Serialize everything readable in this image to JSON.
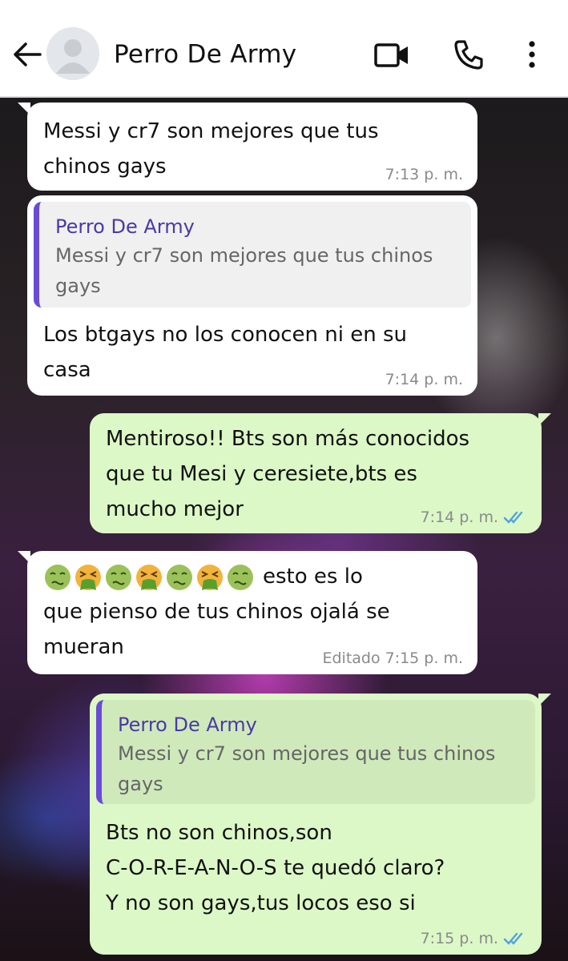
{
  "header": {
    "contact_name": "Perro De Army"
  },
  "messages": [
    {
      "direction": "incoming",
      "text": "Messi y cr7 son mejores que tus\nchinos gays",
      "time": "7:13 p. m."
    },
    {
      "direction": "incoming",
      "quote": {
        "author": "Perro De Army",
        "text": "Messi y cr7 son mejores que tus chinos\ngays"
      },
      "text": "Los btgays no los conocen ni en su\ncasa",
      "time": "7:14 p. m."
    },
    {
      "direction": "outgoing",
      "text": "Mentiroso!! Bts son más conocidos\nque tu Mesi y ceresiete,bts es\nmucho mejor",
      "time": "7:14 p. m.",
      "status": "read"
    },
    {
      "direction": "incoming",
      "emojis": [
        "nauseated-face",
        "vomiting-face",
        "nauseated-face",
        "vomiting-face",
        "nauseated-face",
        "vomiting-face",
        "nauseated-face"
      ],
      "text_first_line": "esto es lo",
      "text": "que pienso de tus chinos ojalá se\nmueran",
      "edited_label": "Editado",
      "time": "7:15 p. m."
    },
    {
      "direction": "outgoing",
      "quote": {
        "author": "Perro De Army",
        "text": "Messi y cr7 son mejores que tus chinos\ngays"
      },
      "text": "Bts no son chinos,son\nC-O-R-E-A-N-O-S te quedó claro?\nY no son gays,tus locos eso si",
      "time": "7:15 p. m.",
      "status": "read"
    }
  ],
  "colors": {
    "incoming_bubble": "#ffffff",
    "outgoing_bubble": "#dcf8c6",
    "quote_bar": "#6a4bd6",
    "quote_author": "#4a39a6",
    "read_check": "#4fa3e0"
  }
}
